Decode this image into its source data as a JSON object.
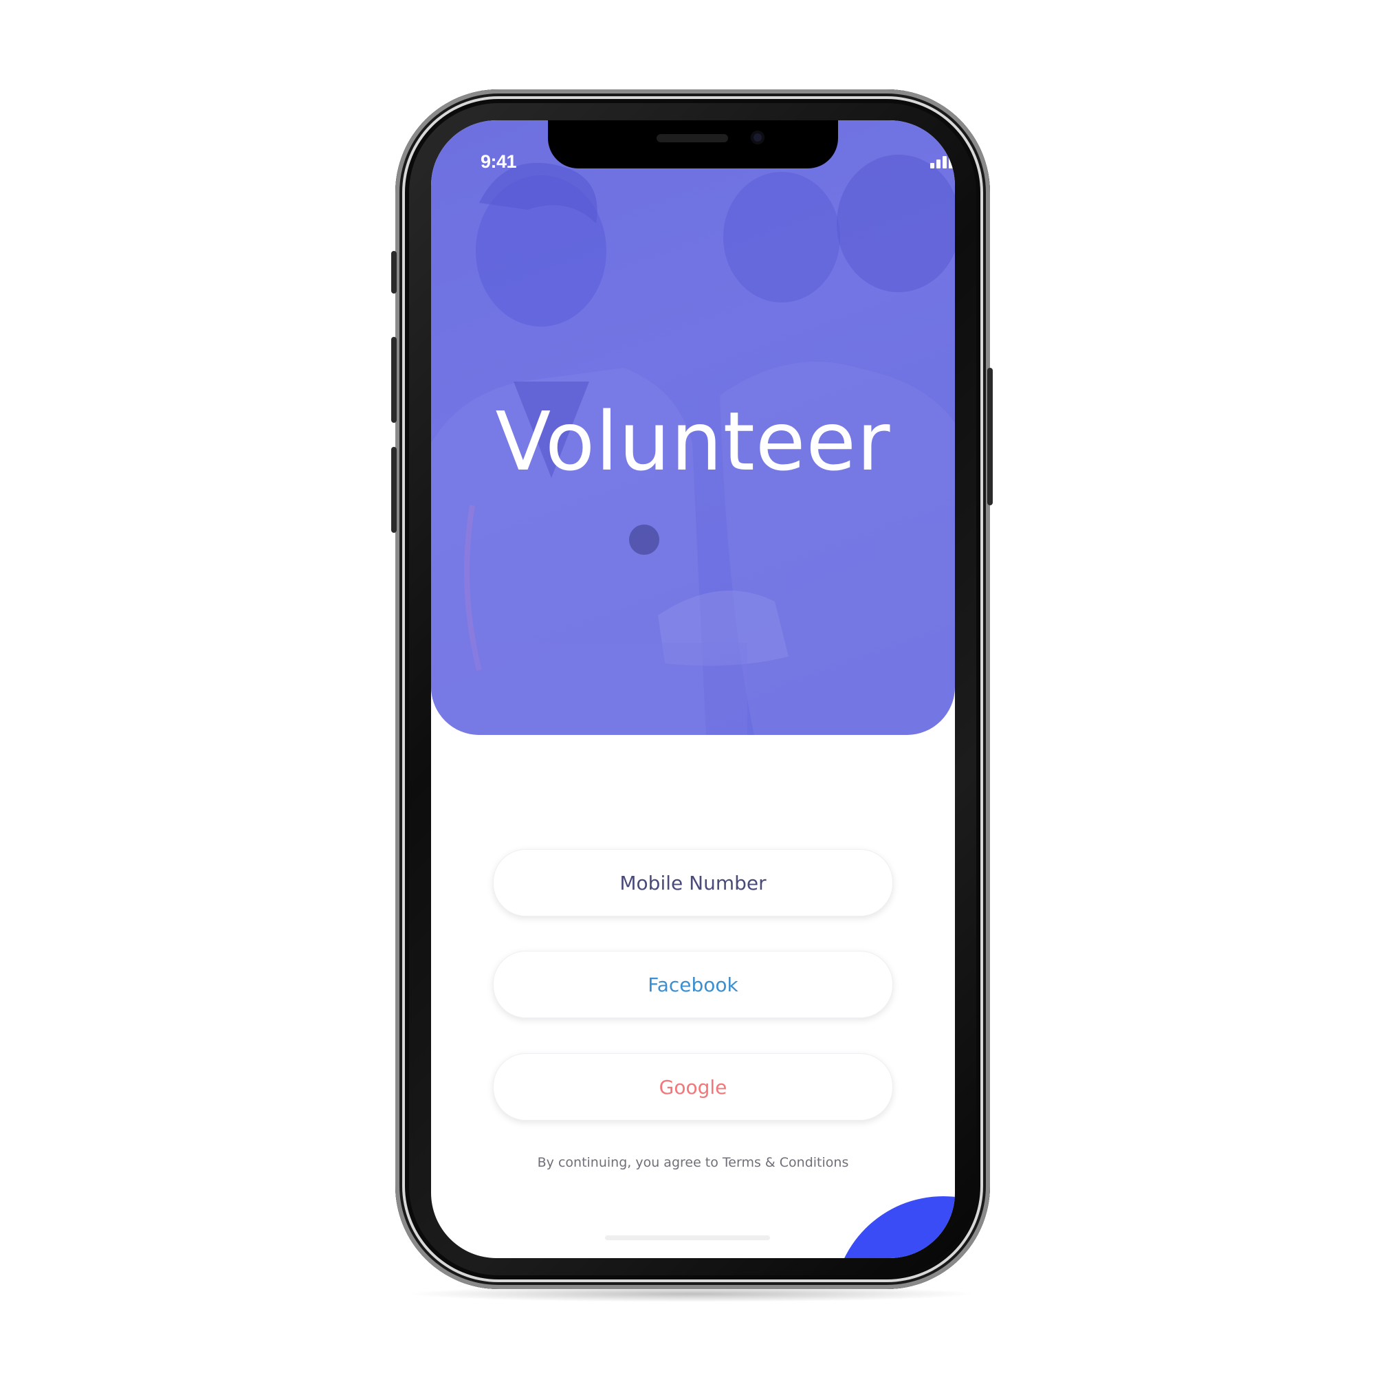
{
  "status_bar": {
    "time": "9:41",
    "icons": [
      "signal-icon",
      "wifi-icon",
      "battery-icon"
    ]
  },
  "hero": {
    "title": "Volunteer"
  },
  "auth_buttons": {
    "mobile_label": "Mobile Number",
    "facebook_label": "Facebook",
    "google_label": "Google"
  },
  "terms_text": "By continuing, you agree to Terms & Conditions",
  "colors": {
    "hero_overlay": "#6e70e0",
    "mobile_text": "#4a4a7a",
    "facebook_text": "#3b8fd0",
    "google_text": "#f2777a",
    "accent_blob": "#3a4cf5"
  }
}
